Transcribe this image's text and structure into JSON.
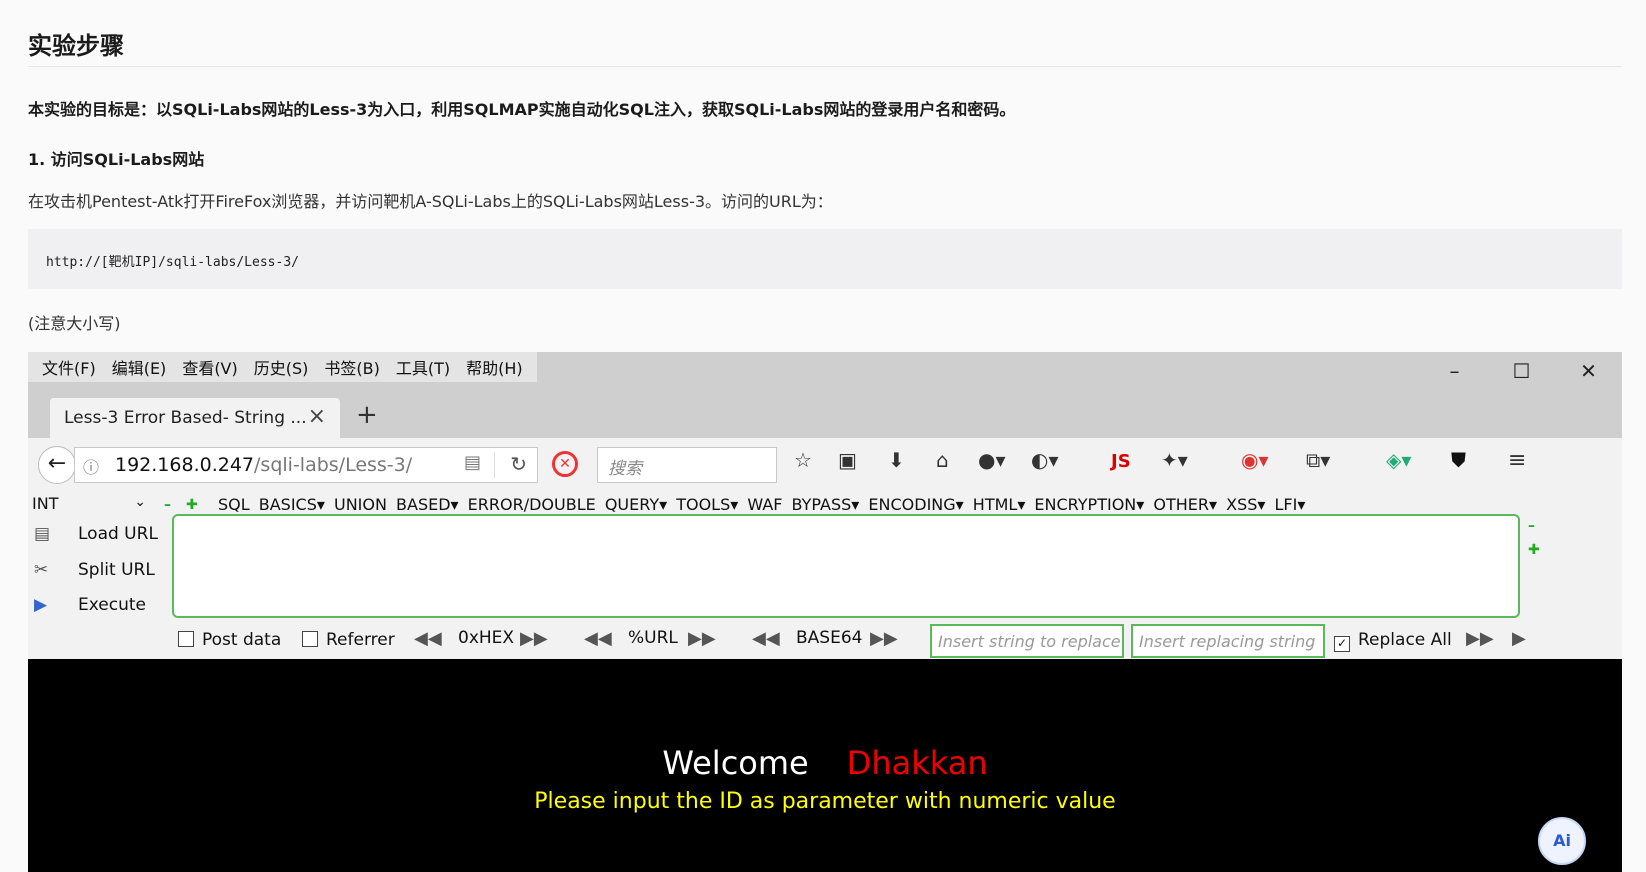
{
  "doc": {
    "heading": "实验步骤",
    "goal": "本实验的目标是：以SQLi-Labs网站的Less-3为入口，利用SQLMAP实施自动化SQL注入，获取SQLi-Labs网站的登录用户名和密码。",
    "step1_title": "1. 访问SQLi-Labs网站",
    "step1_text": "在攻击机Pentest-Atk打开FireFox浏览器，并访问靶机A-SQLi-Labs上的SQLi-Labs网站Less-3。访问的URL为：",
    "code": "http://[靶机IP]/sqli-labs/Less-3/",
    "note": "(注意大小写)"
  },
  "browser": {
    "menu": [
      "文件(F)",
      "编辑(E)",
      "查看(V)",
      "历史(S)",
      "书签(B)",
      "工具(T)",
      "帮助(H)"
    ],
    "tab_title": "Less-3 Error Based- String ...",
    "url_host": "192.168.0.247",
    "url_path": "/sqli-labs/Less-3/",
    "search_placeholder": "搜索",
    "js_label": "JS"
  },
  "hackbar": {
    "select_value": "INT",
    "menu": "SQL BASICS▾  UNION BASED▾  ERROR/DOUBLE QUERY▾  TOOLS▾  WAF BYPASS▾  ENCODING▾  HTML▾  ENCRYPTION▾  OTHER▾  XSS▾  LFI▾",
    "load_url": "Load URL",
    "split_url": "Split URL",
    "execute": "Execute",
    "post_data": "Post data",
    "referrer": "Referrer",
    "hex": "0xHEX",
    "url_enc": "%URL",
    "base64": "BASE64",
    "replace_placeholder": "Insert string to replace",
    "replacing_placeholder": "Insert replacing string",
    "replace_all": "Replace All"
  },
  "page": {
    "welcome": "Welcome",
    "name": "Dhakkan",
    "prompt": "Please input the ID as parameter with numeric value"
  },
  "ai_button": "Ai"
}
